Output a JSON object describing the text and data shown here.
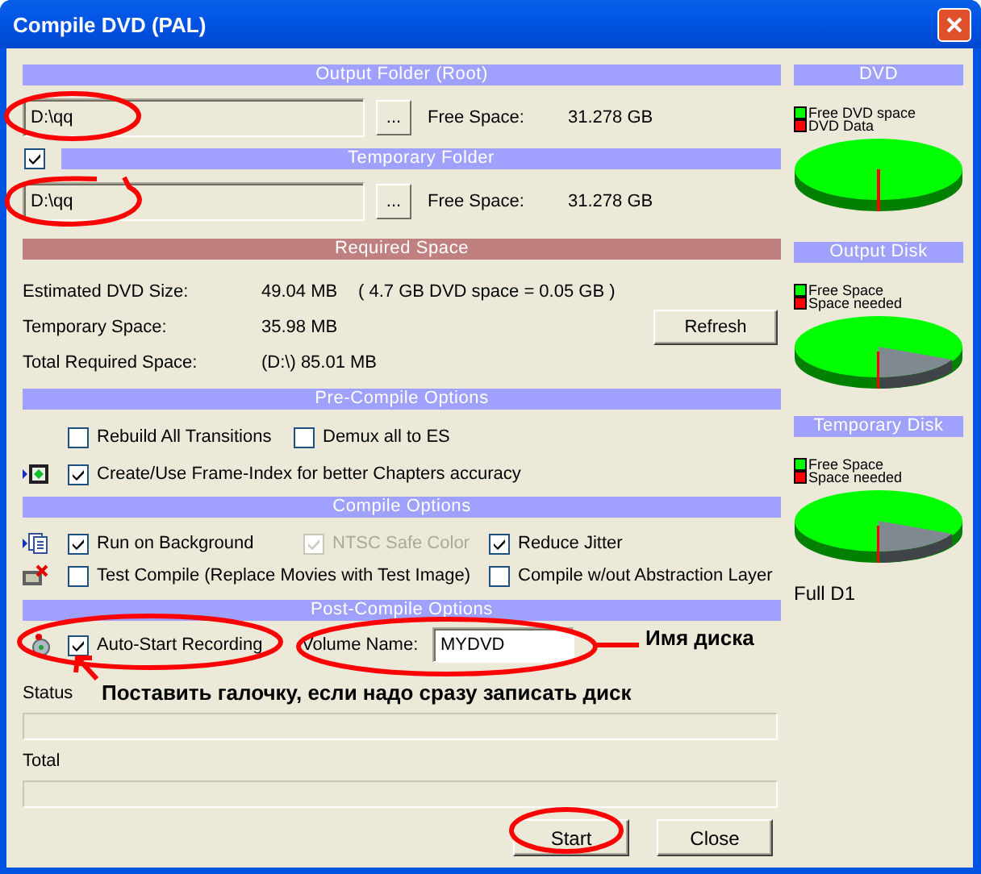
{
  "window": {
    "title": "Compile DVD (PAL)"
  },
  "output_folder": {
    "header": "Output Folder (Root)",
    "path": "D:\\qq",
    "browse": "...",
    "free_label": "Free Space:",
    "free_value": "31.278 GB"
  },
  "temporary_folder": {
    "enabled": true,
    "header": "Temporary Folder",
    "path": "D:\\qq",
    "browse": "...",
    "free_label": "Free Space:",
    "free_value": "31.278 GB"
  },
  "required_space": {
    "header": "Required Space",
    "refresh": "Refresh",
    "rows": [
      {
        "label": "Estimated DVD Size:",
        "value": "49.04 MB",
        "note": "( 4.7 GB DVD space = 0.05 GB )"
      },
      {
        "label": "Temporary Space:",
        "value": "35.98 MB"
      },
      {
        "label": "Total Required Space:",
        "value": "(D:\\) 85.01 MB"
      }
    ]
  },
  "pre_compile": {
    "header": "Pre-Compile Options",
    "options": [
      {
        "label": "Rebuild All Transitions",
        "checked": false,
        "disabled": false
      },
      {
        "label": "Demux all to ES",
        "checked": false,
        "disabled": false
      },
      {
        "label": "Create/Use Frame-Index for better Chapters accuracy",
        "checked": true,
        "disabled": false
      }
    ]
  },
  "compile": {
    "header": "Compile Options",
    "options": [
      {
        "label": "Run on Background",
        "checked": true,
        "disabled": false
      },
      {
        "label": "NTSC Safe Color",
        "checked": true,
        "disabled": true
      },
      {
        "label": "Reduce Jitter",
        "checked": true,
        "disabled": false
      },
      {
        "label": "Test Compile (Replace Movies with Test Image)",
        "checked": false,
        "disabled": false
      },
      {
        "label": "Compile w/out Abstraction Layer",
        "checked": false,
        "disabled": false
      }
    ]
  },
  "post_compile": {
    "header": "Post-Compile Options",
    "auto_start": {
      "label": "Auto-Start Recording",
      "checked": true
    },
    "volume_label": "Volume Name:",
    "volume_value": "MYDVD"
  },
  "progress": [
    {
      "label": "Status",
      "level": 0
    },
    {
      "label": "Total",
      "level": 0
    }
  ],
  "buttons": [
    "Start",
    "Close"
  ],
  "disks": [
    {
      "kind": "dvd",
      "header": "DVD",
      "legend": [
        {
          "label": "Free DVD space",
          "color": "#00ff00"
        },
        {
          "label": "DVD Data",
          "color": "#ff0000"
        }
      ]
    },
    {
      "kind": "disk",
      "header": "Output Disk",
      "legend": [
        {
          "label": "Free Space",
          "color": "#00ff00"
        },
        {
          "label": "Space needed",
          "color": "#ff0000"
        }
      ]
    },
    {
      "kind": "disk",
      "header": "Temporary Disk",
      "legend": [
        {
          "label": "Free Space",
          "color": "#00ff00"
        },
        {
          "label": "Space needed",
          "color": "#ff0000"
        }
      ]
    }
  ],
  "profile": "Full D1",
  "annotations": {
    "volume_note": "Имя диска",
    "checkbox_note": "Поставить галочку, если надо сразу записать диск"
  }
}
